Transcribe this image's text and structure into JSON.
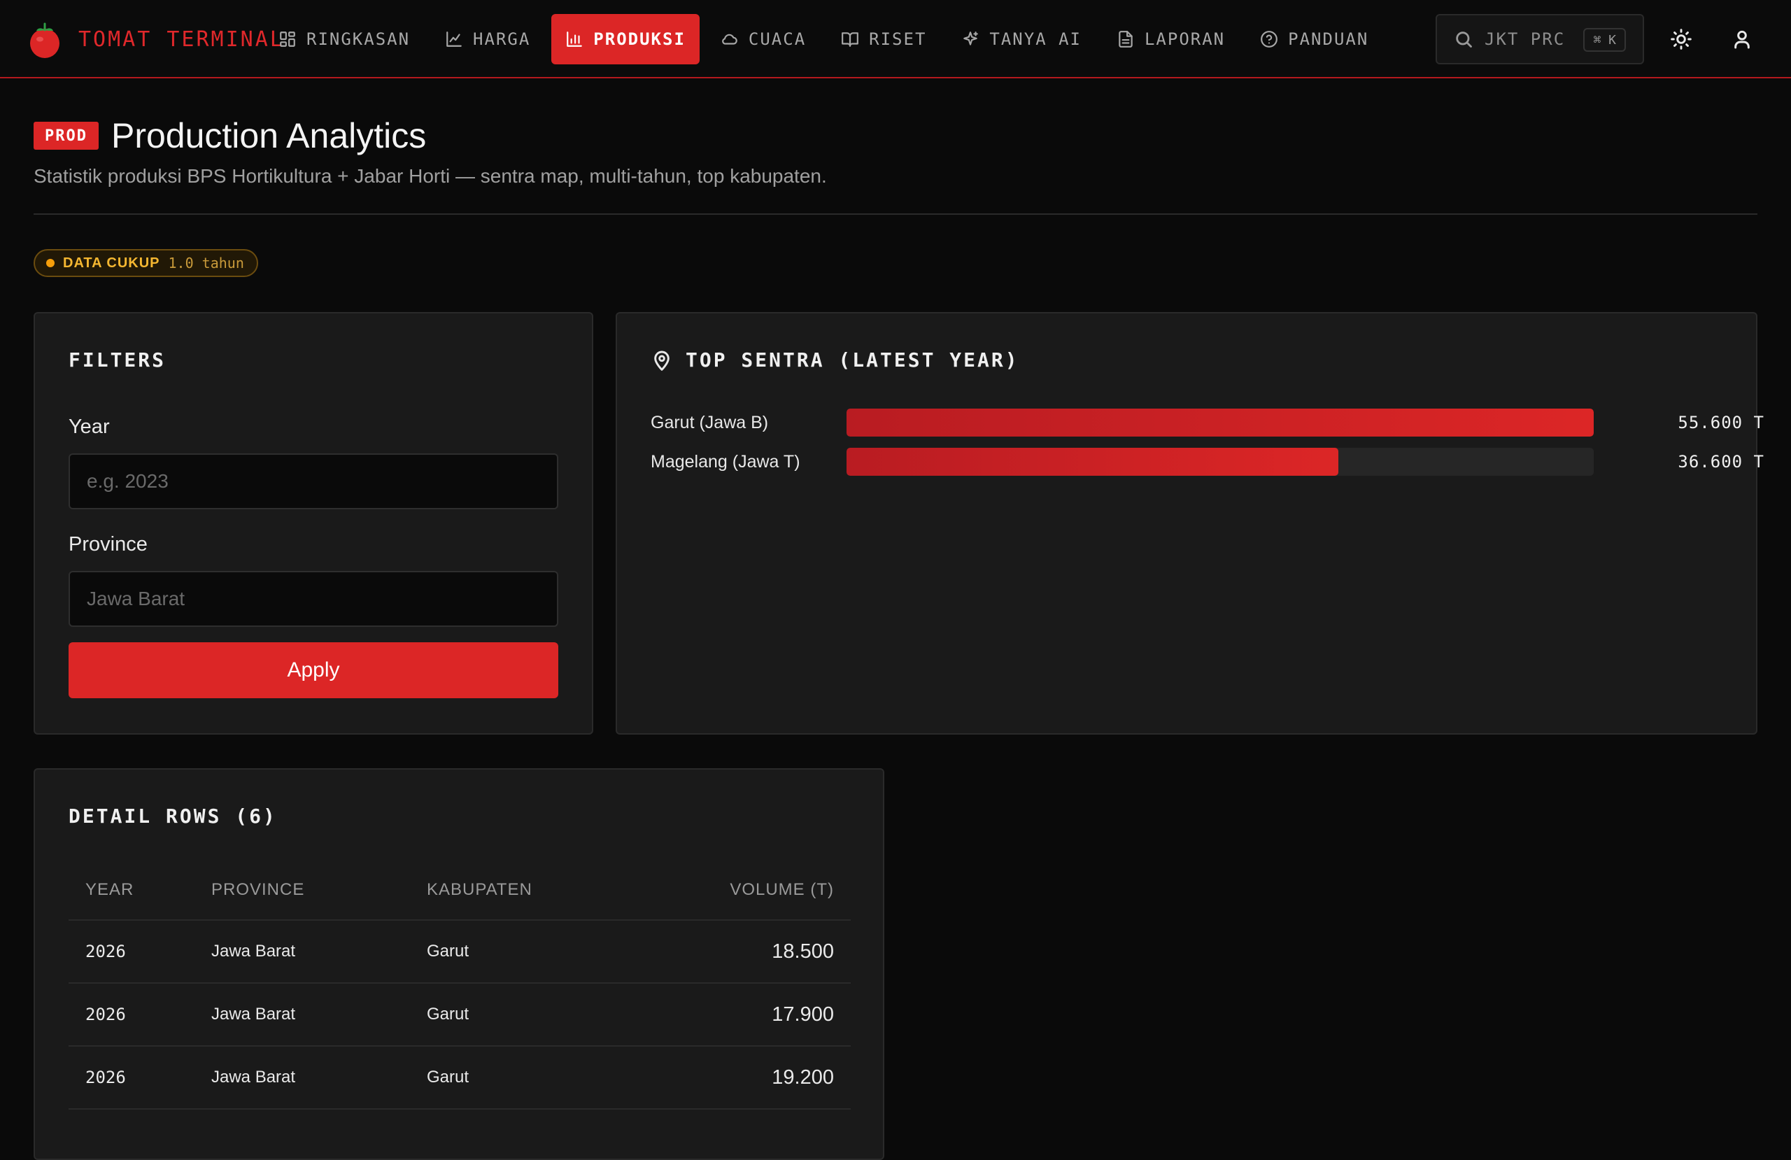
{
  "app": {
    "name": "TOMAT TERMINAL",
    "logo_icon": "tomato-icon"
  },
  "nav": [
    {
      "label": "RINGKASAN",
      "icon": "dashboard-icon",
      "active": false
    },
    {
      "label": "HARGA",
      "icon": "line-chart-icon",
      "active": false
    },
    {
      "label": "PRODUKSI",
      "icon": "bar-chart-icon",
      "active": true
    },
    {
      "label": "CUACA",
      "icon": "cloud-icon",
      "active": false
    },
    {
      "label": "RISET",
      "icon": "book-icon",
      "active": false
    },
    {
      "label": "TANYA AI",
      "icon": "sparkle-icon",
      "active": false
    },
    {
      "label": "LAPORAN",
      "icon": "document-icon",
      "active": false
    },
    {
      "label": "PANDUAN",
      "icon": "help-icon",
      "active": false
    }
  ],
  "search": {
    "text": "JKT PRC",
    "shortcut": "⌘ K"
  },
  "header": {
    "badge": "PROD",
    "title": "Production Analytics",
    "subtitle": "Statistik produksi BPS Hortikultura + Jabar Horti — sentra map, multi-tahun, top kabupaten."
  },
  "status": {
    "label": "DATA CUKUP",
    "value": "1.0 tahun",
    "color": "#f59e0b"
  },
  "filters": {
    "title": "FILTERS",
    "year_label": "Year",
    "year_placeholder": "e.g. 2023",
    "year_value": "",
    "province_label": "Province",
    "province_placeholder": "Jawa Barat",
    "province_value": "",
    "apply_label": "Apply"
  },
  "top_sentra": {
    "title": "TOP SENTRA (LATEST YEAR)",
    "max_value": 55600,
    "items": [
      {
        "label": "Garut (Jawa B)",
        "value": 55600,
        "value_text": "55.600 T"
      },
      {
        "label": "Magelang (Jawa T)",
        "value": 36600,
        "value_text": "36.600 T"
      }
    ]
  },
  "detail": {
    "title": "DETAIL ROWS (6)",
    "columns": [
      "YEAR",
      "PROVINCE",
      "KABUPATEN",
      "VOLUME (T)"
    ],
    "rows": [
      [
        "2026",
        "Jawa Barat",
        "Garut",
        "18.500"
      ],
      [
        "2026",
        "Jawa Barat",
        "Garut",
        "17.900"
      ],
      [
        "2026",
        "Jawa Barat",
        "Garut",
        "19.200"
      ]
    ]
  },
  "colors": {
    "accent": "#dc2626",
    "background": "#0a0a0a",
    "card": "#1a1a1a"
  }
}
